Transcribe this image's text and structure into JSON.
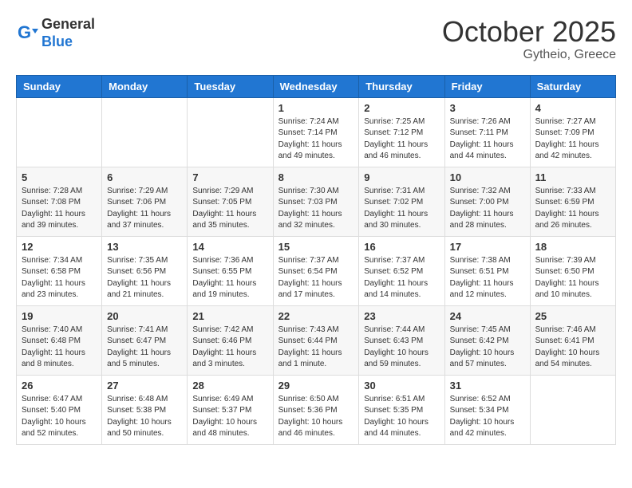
{
  "logo": {
    "text_general": "General",
    "text_blue": "Blue"
  },
  "title": {
    "month_year": "October 2025",
    "location": "Gytheio, Greece"
  },
  "weekdays": [
    "Sunday",
    "Monday",
    "Tuesday",
    "Wednesday",
    "Thursday",
    "Friday",
    "Saturday"
  ],
  "weeks": [
    [
      {
        "day": "",
        "info": ""
      },
      {
        "day": "",
        "info": ""
      },
      {
        "day": "",
        "info": ""
      },
      {
        "day": "1",
        "info": "Sunrise: 7:24 AM\nSunset: 7:14 PM\nDaylight: 11 hours\nand 49 minutes."
      },
      {
        "day": "2",
        "info": "Sunrise: 7:25 AM\nSunset: 7:12 PM\nDaylight: 11 hours\nand 46 minutes."
      },
      {
        "day": "3",
        "info": "Sunrise: 7:26 AM\nSunset: 7:11 PM\nDaylight: 11 hours\nand 44 minutes."
      },
      {
        "day": "4",
        "info": "Sunrise: 7:27 AM\nSunset: 7:09 PM\nDaylight: 11 hours\nand 42 minutes."
      }
    ],
    [
      {
        "day": "5",
        "info": "Sunrise: 7:28 AM\nSunset: 7:08 PM\nDaylight: 11 hours\nand 39 minutes."
      },
      {
        "day": "6",
        "info": "Sunrise: 7:29 AM\nSunset: 7:06 PM\nDaylight: 11 hours\nand 37 minutes."
      },
      {
        "day": "7",
        "info": "Sunrise: 7:29 AM\nSunset: 7:05 PM\nDaylight: 11 hours\nand 35 minutes."
      },
      {
        "day": "8",
        "info": "Sunrise: 7:30 AM\nSunset: 7:03 PM\nDaylight: 11 hours\nand 32 minutes."
      },
      {
        "day": "9",
        "info": "Sunrise: 7:31 AM\nSunset: 7:02 PM\nDaylight: 11 hours\nand 30 minutes."
      },
      {
        "day": "10",
        "info": "Sunrise: 7:32 AM\nSunset: 7:00 PM\nDaylight: 11 hours\nand 28 minutes."
      },
      {
        "day": "11",
        "info": "Sunrise: 7:33 AM\nSunset: 6:59 PM\nDaylight: 11 hours\nand 26 minutes."
      }
    ],
    [
      {
        "day": "12",
        "info": "Sunrise: 7:34 AM\nSunset: 6:58 PM\nDaylight: 11 hours\nand 23 minutes."
      },
      {
        "day": "13",
        "info": "Sunrise: 7:35 AM\nSunset: 6:56 PM\nDaylight: 11 hours\nand 21 minutes."
      },
      {
        "day": "14",
        "info": "Sunrise: 7:36 AM\nSunset: 6:55 PM\nDaylight: 11 hours\nand 19 minutes."
      },
      {
        "day": "15",
        "info": "Sunrise: 7:37 AM\nSunset: 6:54 PM\nDaylight: 11 hours\nand 17 minutes."
      },
      {
        "day": "16",
        "info": "Sunrise: 7:37 AM\nSunset: 6:52 PM\nDaylight: 11 hours\nand 14 minutes."
      },
      {
        "day": "17",
        "info": "Sunrise: 7:38 AM\nSunset: 6:51 PM\nDaylight: 11 hours\nand 12 minutes."
      },
      {
        "day": "18",
        "info": "Sunrise: 7:39 AM\nSunset: 6:50 PM\nDaylight: 11 hours\nand 10 minutes."
      }
    ],
    [
      {
        "day": "19",
        "info": "Sunrise: 7:40 AM\nSunset: 6:48 PM\nDaylight: 11 hours\nand 8 minutes."
      },
      {
        "day": "20",
        "info": "Sunrise: 7:41 AM\nSunset: 6:47 PM\nDaylight: 11 hours\nand 5 minutes."
      },
      {
        "day": "21",
        "info": "Sunrise: 7:42 AM\nSunset: 6:46 PM\nDaylight: 11 hours\nand 3 minutes."
      },
      {
        "day": "22",
        "info": "Sunrise: 7:43 AM\nSunset: 6:44 PM\nDaylight: 11 hours\nand 1 minute."
      },
      {
        "day": "23",
        "info": "Sunrise: 7:44 AM\nSunset: 6:43 PM\nDaylight: 10 hours\nand 59 minutes."
      },
      {
        "day": "24",
        "info": "Sunrise: 7:45 AM\nSunset: 6:42 PM\nDaylight: 10 hours\nand 57 minutes."
      },
      {
        "day": "25",
        "info": "Sunrise: 7:46 AM\nSunset: 6:41 PM\nDaylight: 10 hours\nand 54 minutes."
      }
    ],
    [
      {
        "day": "26",
        "info": "Sunrise: 6:47 AM\nSunset: 5:40 PM\nDaylight: 10 hours\nand 52 minutes."
      },
      {
        "day": "27",
        "info": "Sunrise: 6:48 AM\nSunset: 5:38 PM\nDaylight: 10 hours\nand 50 minutes."
      },
      {
        "day": "28",
        "info": "Sunrise: 6:49 AM\nSunset: 5:37 PM\nDaylight: 10 hours\nand 48 minutes."
      },
      {
        "day": "29",
        "info": "Sunrise: 6:50 AM\nSunset: 5:36 PM\nDaylight: 10 hours\nand 46 minutes."
      },
      {
        "day": "30",
        "info": "Sunrise: 6:51 AM\nSunset: 5:35 PM\nDaylight: 10 hours\nand 44 minutes."
      },
      {
        "day": "31",
        "info": "Sunrise: 6:52 AM\nSunset: 5:34 PM\nDaylight: 10 hours\nand 42 minutes."
      },
      {
        "day": "",
        "info": ""
      }
    ]
  ]
}
